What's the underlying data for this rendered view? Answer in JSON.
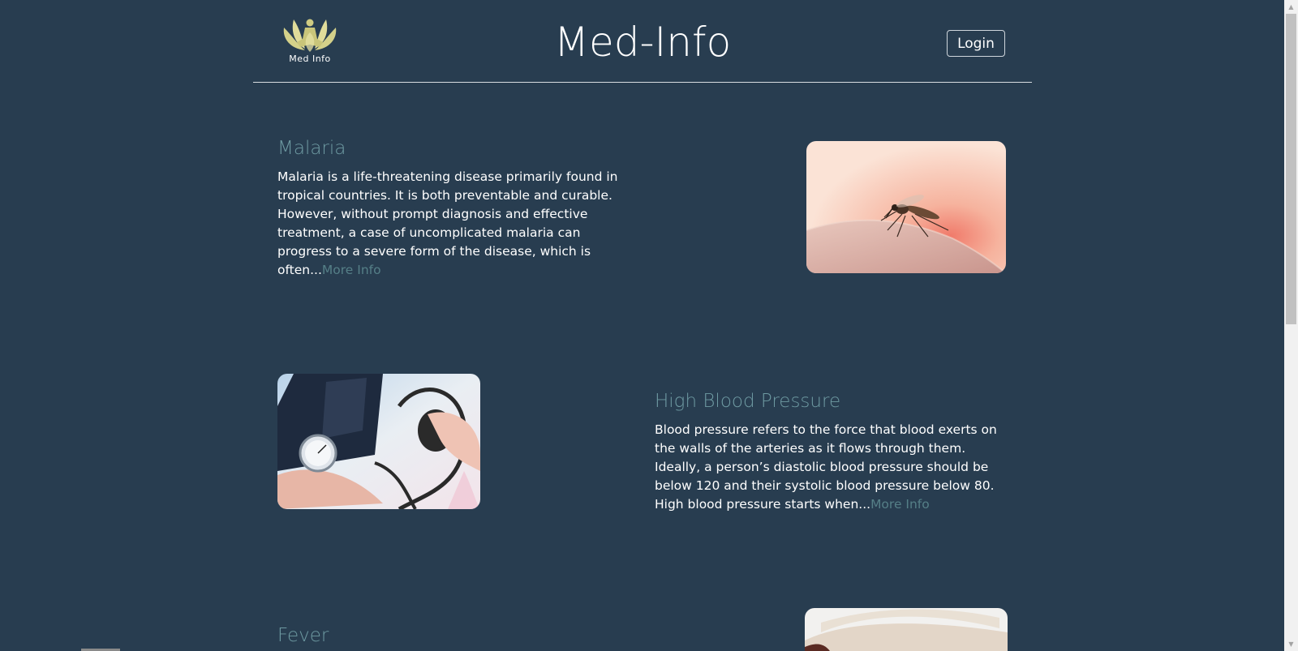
{
  "header": {
    "logo_text": "Med Info",
    "title": "Med-Info",
    "login_label": "Login"
  },
  "articles": [
    {
      "title": "Malaria",
      "text": "Malaria is a life-threatening disease primarily found in tropical countries. It is both preventable and curable. However, without prompt diagnosis and effective treatment, a case of uncomplicated malaria can progress to a severe form of the disease, which is often...",
      "more_label": "More Info"
    },
    {
      "title": "High Blood Pressure",
      "text": "Blood pressure refers to the force that blood exerts on the walls of the arteries as it flows through them. Ideally, a person’s diastolic blood pressure should be below 120 and their systolic blood pressure below 80. High blood pressure starts when...",
      "more_label": "More Info"
    },
    {
      "title": "Fever"
    }
  ],
  "colors": {
    "background": "#283d50",
    "title_accent": "#6e9aa2",
    "link": "#557f87",
    "logo_gold": "#d8d58e"
  }
}
